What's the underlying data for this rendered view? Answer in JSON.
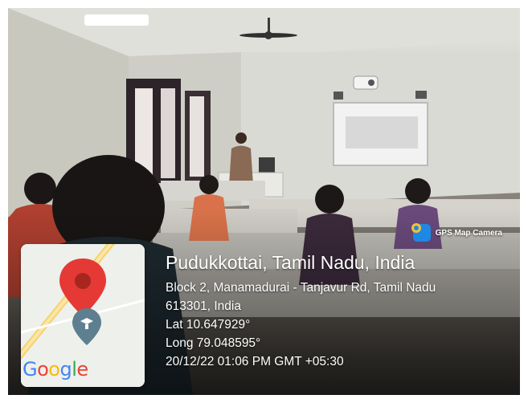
{
  "app_badge": {
    "label": "GPS Map Camera",
    "icon": "gps-camera-app-icon"
  },
  "map": {
    "brand": "Google",
    "brand_colors": [
      "#4285F4",
      "#EA4335",
      "#FBBC05",
      "#4285F4",
      "#34A853",
      "#EA4335"
    ],
    "pin_color": "#E53935"
  },
  "location": {
    "place": "Pudukkottai, Tamil Nadu, India",
    "address_line1": "Block 2, Manamadurai - Tanjavur Rd, Tamil Nadu",
    "address_line2": "613301, India",
    "latitude": "Lat 10.647929°",
    "longitude": "Long 79.048595°",
    "datetime": "20/12/22 01:06 PM GMT +05:30"
  }
}
